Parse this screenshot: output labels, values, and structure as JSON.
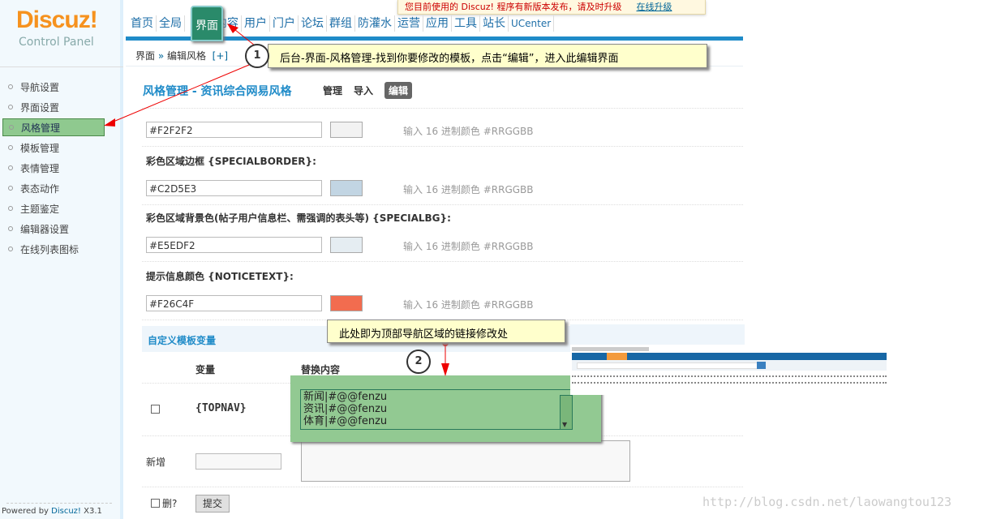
{
  "banner": {
    "text": "您目前使用的 Discuz! 程序有新版本发布，请及时升级",
    "link": "在线升级"
  },
  "logo": {
    "brand": "Discuz!",
    "sub": "Control Panel"
  },
  "nav": [
    "首页",
    "全局",
    "界面",
    "内容",
    "用户",
    "门户",
    "论坛",
    "群组",
    "防灌水",
    "运营",
    "应用",
    "工具",
    "站长",
    "UCenter"
  ],
  "nav_active": "界面",
  "breadcrumb": {
    "a": "界面",
    "sep": " » ",
    "b": "编辑风格",
    "add": "[+]"
  },
  "sidebar": {
    "items": [
      "导航设置",
      "界面设置",
      "风格管理",
      "模板管理",
      "表情管理",
      "表态动作",
      "主题鉴定",
      "编辑器设置",
      "在线列表图标"
    ],
    "active": "风格管理"
  },
  "powered": {
    "prefix": "Powered by ",
    "brand": "Discuz!",
    "version": " X3.1"
  },
  "page": {
    "title": "风格管理 - 资讯综合网易风格",
    "tabs": [
      "管理",
      "导入",
      "编辑"
    ]
  },
  "colors": [
    {
      "label": "",
      "value": "#F2F2F2",
      "hint": "输入 16 进制颜色 #RRGGBB"
    },
    {
      "label": "彩色区域边框 {SPECIALBORDER}:",
      "value": "#C2D5E3",
      "hint": "输入 16 进制颜色 #RRGGBB"
    },
    {
      "label": "彩色区域背景色(帖子用户信息栏、需强调的表头等) {SPECIALBG}:",
      "value": "#E5EDF2",
      "hint": "输入 16 进制颜色 #RRGGBB"
    },
    {
      "label": "提示信息颜色 {NOTICETEXT}:",
      "value": "#F26C4F",
      "hint": "输入 16 进制颜色 #RRGGBB"
    }
  ],
  "custom": {
    "section": "自定义模板变量",
    "col_var": "变量",
    "col_content": "替换内容",
    "var": "{TOPNAV}",
    "content": [
      "新闻|#@@fenzu",
      "资讯|#@@fenzu",
      "体育|#@@fenzu"
    ],
    "new_label": "新增",
    "del_label": "删?",
    "submit": "提交"
  },
  "annotations": {
    "n1": "1",
    "text1": "后台-界面-风格管理-找到你要修改的模板，点击“编辑”，进入此编辑界面",
    "n2": "2",
    "text2": "此处即为顶部导航区域的链接修改处",
    "arrow_color": "#e00000"
  },
  "watermark": "http://blog.csdn.net/laowangtou123"
}
